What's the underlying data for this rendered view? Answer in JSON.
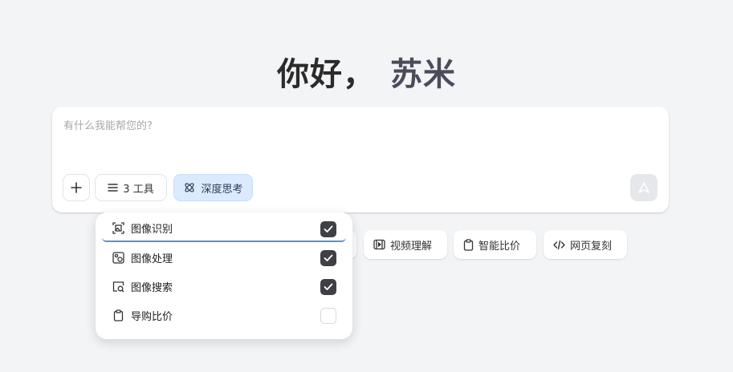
{
  "greeting": {
    "hello": "你好",
    "separator": "，",
    "name": "苏米"
  },
  "composer": {
    "placeholder": "有什么我能帮您的?",
    "tools_label": "3 工具",
    "deep_think_label": "深度思考"
  },
  "quick_actions": [
    {
      "label": "视频理解",
      "icon": "video-icon"
    },
    {
      "label": "智能比价",
      "icon": "clipboard-icon"
    },
    {
      "label": "网页复刻",
      "icon": "code-icon"
    }
  ],
  "tools_menu": [
    {
      "label": "图像识别",
      "icon": "image-scan-icon",
      "checked": true
    },
    {
      "label": "图像处理",
      "icon": "image-edit-icon",
      "checked": true
    },
    {
      "label": "图像搜索",
      "icon": "image-search-icon",
      "checked": true
    },
    {
      "label": "导购比价",
      "icon": "clipboard-icon",
      "checked": false
    }
  ],
  "colors": {
    "accent_bg": "#dbeafe",
    "check_bg": "#3f3f46",
    "focus_line": "#5b8fd6"
  }
}
